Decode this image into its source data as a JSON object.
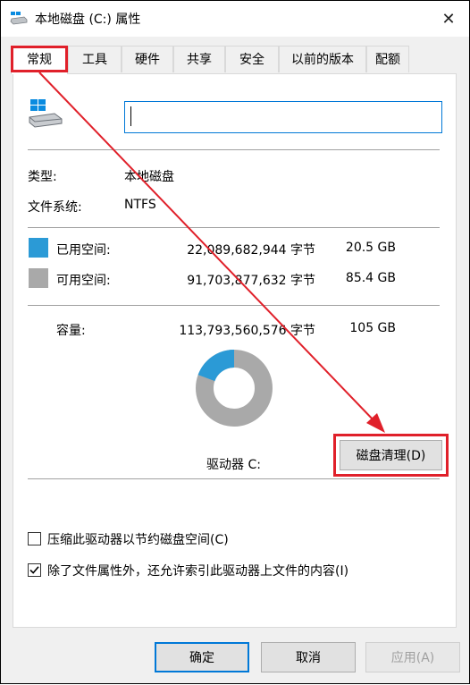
{
  "window": {
    "title": "本地磁盘 (C:) 属性",
    "close_glyph": "✕"
  },
  "tabs": [
    {
      "label": "常规",
      "active": true
    },
    {
      "label": "工具"
    },
    {
      "label": "硬件"
    },
    {
      "label": "共享"
    },
    {
      "label": "安全"
    },
    {
      "label": "以前的版本"
    },
    {
      "label": "配额"
    }
  ],
  "general": {
    "drive_name_value": "",
    "type_label": "类型:",
    "type_value": "本地磁盘",
    "fs_label": "文件系统:",
    "fs_value": "NTFS",
    "used": {
      "label": "已用空间:",
      "bytes": "22,089,682,944 字节",
      "size": "20.5 GB",
      "color": "#2b9ad6"
    },
    "free": {
      "label": "可用空间:",
      "bytes": "91,703,877,632 字节",
      "size": "85.4 GB",
      "color": "#a9a9a9"
    },
    "capacity": {
      "label": "容量:",
      "bytes": "113,793,560,576 字节",
      "size": "105 GB"
    },
    "used_fraction": 0.194,
    "drive_label": "驱动器 C:",
    "cleanup_button": "磁盘清理(D)",
    "compress_checkbox": {
      "label": "压缩此驱动器以节约磁盘空间(C)",
      "checked": false
    },
    "index_checkbox": {
      "label": "除了文件属性外，还允许索引此驱动器上文件的内容(I)",
      "checked": true
    }
  },
  "footer": {
    "ok": "确定",
    "cancel": "取消",
    "apply": "应用(A)"
  },
  "annotation_color": "#e0202a"
}
